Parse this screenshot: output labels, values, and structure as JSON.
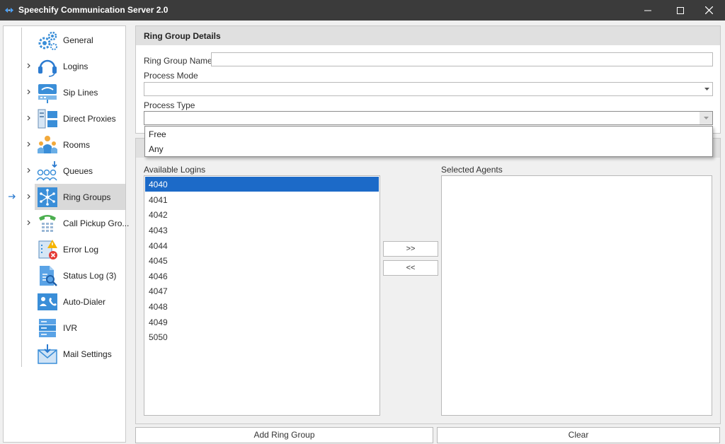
{
  "window": {
    "title": "Speechify Communication Server 2.0"
  },
  "sidebar": {
    "items": [
      {
        "label": "General",
        "icon": "gears-icon",
        "expandable": false
      },
      {
        "label": "Logins",
        "icon": "headset-icon",
        "expandable": true
      },
      {
        "label": "Sip Lines",
        "icon": "phone-network-icon",
        "expandable": true
      },
      {
        "label": "Direct Proxies",
        "icon": "servers-icon",
        "expandable": true
      },
      {
        "label": "Rooms",
        "icon": "people-room-icon",
        "expandable": true
      },
      {
        "label": "Queues",
        "icon": "queue-people-icon",
        "expandable": true
      },
      {
        "label": "Ring Groups",
        "icon": "ring-group-icon",
        "expandable": true,
        "selected": true
      },
      {
        "label": "Call Pickup Gro...",
        "icon": "call-pickup-icon",
        "expandable": true
      },
      {
        "label": "Error Log",
        "icon": "error-log-icon",
        "expandable": false
      },
      {
        "label": "Status Log (3)",
        "icon": "status-log-icon",
        "expandable": false
      },
      {
        "label": "Auto-Dialer",
        "icon": "auto-dialer-icon",
        "expandable": false
      },
      {
        "label": "IVR",
        "icon": "ivr-icon",
        "expandable": false
      },
      {
        "label": "Mail Settings",
        "icon": "mail-icon",
        "expandable": false
      }
    ]
  },
  "details": {
    "header": "Ring Group Details",
    "name_label": "Ring Group Name:",
    "name_value": "",
    "process_mode_label": "Process Mode",
    "process_mode_value": "",
    "process_type_label": "Process Type",
    "process_type_value": "",
    "process_type_options": [
      "Free",
      "Any"
    ]
  },
  "agents": {
    "available_label": "Available Logins",
    "selected_label": "Selected Agents",
    "available": [
      "4040",
      "4041",
      "4042",
      "4043",
      "4044",
      "4045",
      "4046",
      "4047",
      "4048",
      "4049",
      "5050"
    ],
    "selected": [],
    "add_button": ">>",
    "remove_button": "<<"
  },
  "footer": {
    "add_label": "Add Ring Group",
    "clear_label": "Clear"
  },
  "colors": {
    "titlebar": "#3b3b3b",
    "selection": "#1c6ac8",
    "panel_header": "#e0e0e0"
  }
}
